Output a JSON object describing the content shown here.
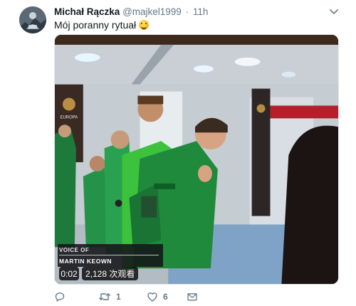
{
  "tweet": {
    "author_name": "Michał Rączka",
    "handle": "@majkel1999",
    "separator": "·",
    "time": "11h",
    "text": "Mój poranny rytuał",
    "emoji": "smiling-face-emoji"
  },
  "video": {
    "caption_line1": "VOICE OF",
    "caption_line2": "MARTIN KEOWN",
    "duration": "0:02",
    "views": "2,128 次观看"
  },
  "actions": {
    "reply_count": "",
    "retweet_count": "1",
    "like_count": "6"
  },
  "colors": {
    "text_primary": "#14171a",
    "text_secondary": "#657786",
    "pitch_green": "#1f8a3c"
  }
}
